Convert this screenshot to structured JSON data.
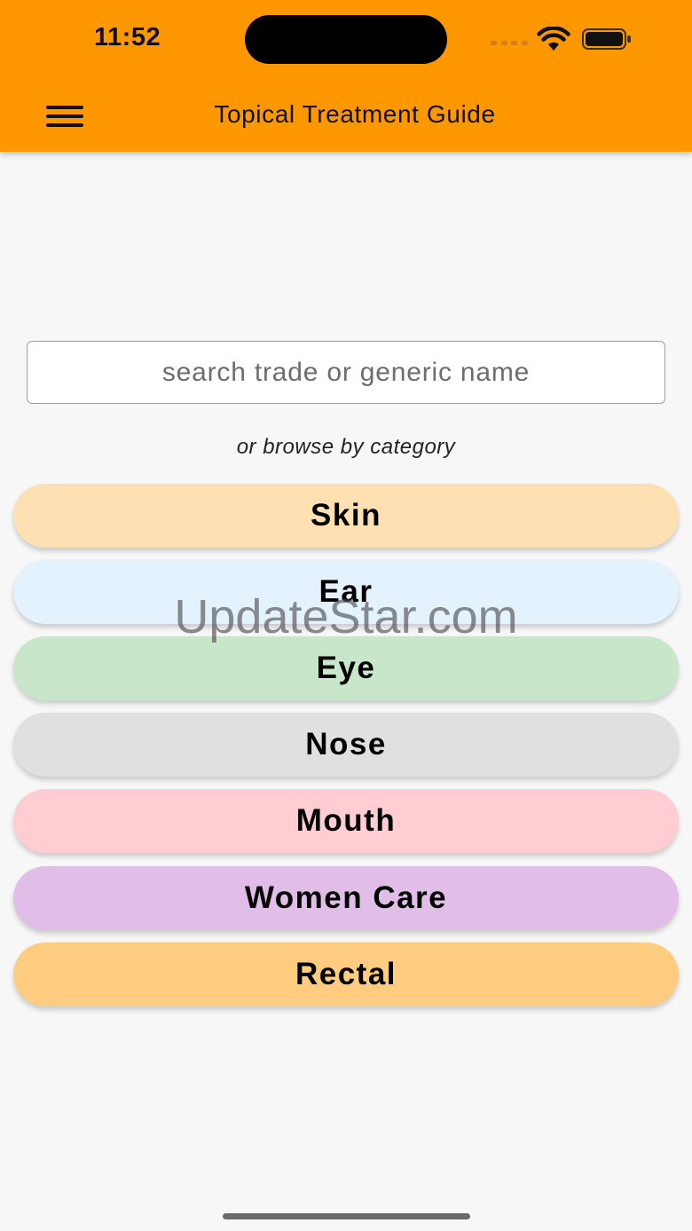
{
  "status_bar": {
    "time": "11:52"
  },
  "app_bar": {
    "title": "Topical Treatment Guide",
    "background": "#ff9800"
  },
  "search": {
    "placeholder": "search trade or generic name",
    "value": ""
  },
  "browse_label": "or browse by category",
  "categories": [
    {
      "label": "Skin",
      "color": "#ffe0b2"
    },
    {
      "label": "Ear",
      "color": "#e3f2fd"
    },
    {
      "label": "Eye",
      "color": "#c8e6c9"
    },
    {
      "label": "Nose",
      "color": "#e0e0e0"
    },
    {
      "label": "Mouth",
      "color": "#ffcdd2"
    },
    {
      "label": "Women Care",
      "color": "#e1bee7"
    },
    {
      "label": "Rectal",
      "color": "#ffcc80"
    }
  ],
  "watermark": "UpdateStar.com"
}
